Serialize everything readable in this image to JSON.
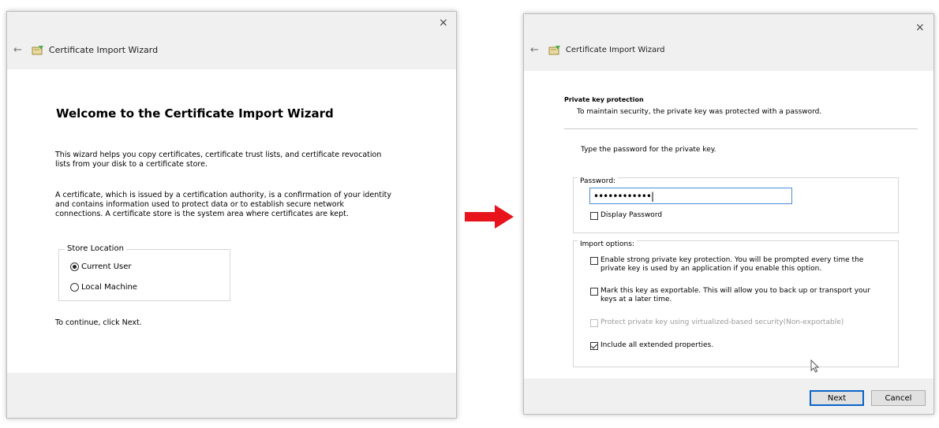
{
  "left_dialog": {
    "close_label": "×",
    "back_label": "←",
    "title": "Certificate Import Wizard",
    "heading": "Welcome to the Certificate Import Wizard",
    "intro_line1": "This wizard helps you copy certificates, certificate trust lists, and certificate revocation",
    "intro_line2": "lists from your disk to a certificate store.",
    "desc_line1": "A certificate, which is issued by a certification authority, is a confirmation of your identity",
    "desc_line2": "and contains information used to protect data or to establish secure network",
    "desc_line3": "connections. A certificate store is the system area where certificates are kept.",
    "store_location_label": "Store Location",
    "store_options": [
      {
        "label": "Current User",
        "selected": true
      },
      {
        "label": "Local Machine",
        "selected": false
      }
    ],
    "continue_text": "To continue, click Next."
  },
  "right_dialog": {
    "close_label": "×",
    "back_label": "←",
    "title": "Certificate Import Wizard",
    "section_title": "Private key protection",
    "section_subtitle": "To maintain security, the private key was protected with a password.",
    "prompt": "Type the password for the private key.",
    "password_label": "Password:",
    "password_value": "••••••••••••|",
    "display_password_label": "Display Password",
    "display_password_checked": false,
    "import_options_label": "Import options:",
    "options": [
      {
        "line1": "Enable strong private key protection. You will be prompted every time the",
        "line2": "private key is used by an application if you enable this option.",
        "checked": false,
        "enabled": true
      },
      {
        "line1": "Mark this key as exportable. This will allow you to back up or transport your",
        "line2": "keys at a later time.",
        "checked": false,
        "enabled": true
      },
      {
        "line1": "Protect private key using virtualized-based security(Non-exportable)",
        "line2": "",
        "checked": false,
        "enabled": false
      },
      {
        "line1": "Include all extended properties.",
        "line2": "",
        "checked": true,
        "enabled": true
      }
    ],
    "next_label": "Next",
    "cancel_label": "Cancel"
  },
  "colors": {
    "arrow": "#e8141b",
    "input_focus_border": "#4a8fd8",
    "primary_button_border": "#0a64c8"
  },
  "icons": [
    "close-icon",
    "back-arrow-icon",
    "certificate-wizard-icon",
    "mouse-cursor-icon",
    "right-arrow-icon"
  ]
}
